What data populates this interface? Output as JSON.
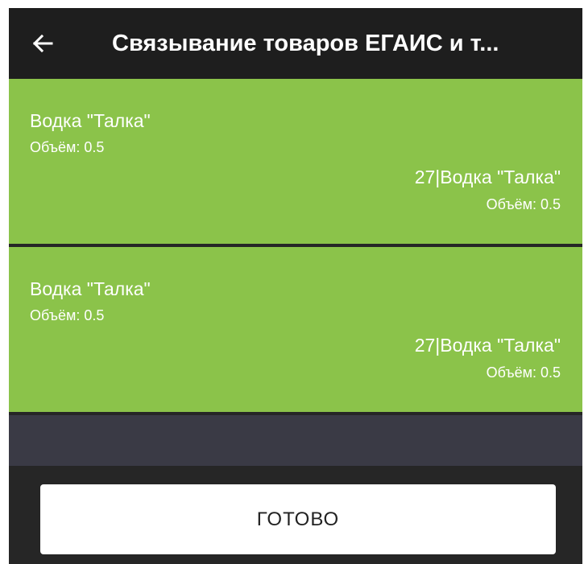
{
  "appbar": {
    "title": "Связывание товаров ЕГАИС и т...",
    "back_icon": "arrow-left-icon"
  },
  "items": [
    {
      "egais_name": "Водка \"Талка\"",
      "egais_volume": "Объём: 0.5",
      "local_name": "27|Водка \"Талка\"",
      "local_volume": "Объём: 0.5"
    },
    {
      "egais_name": "Водка \"Талка\"",
      "egais_volume": "Объём: 0.5",
      "local_name": "27|Водка \"Талка\"",
      "local_volume": "Объём: 0.5"
    }
  ],
  "done_button": {
    "label": "ГОТОВО"
  },
  "colors": {
    "appbar": "#1e1e1e",
    "card": "#8bc34a",
    "empty_area": "#3a3a45",
    "bottom_bar": "#262626",
    "button": "#ffffff"
  }
}
